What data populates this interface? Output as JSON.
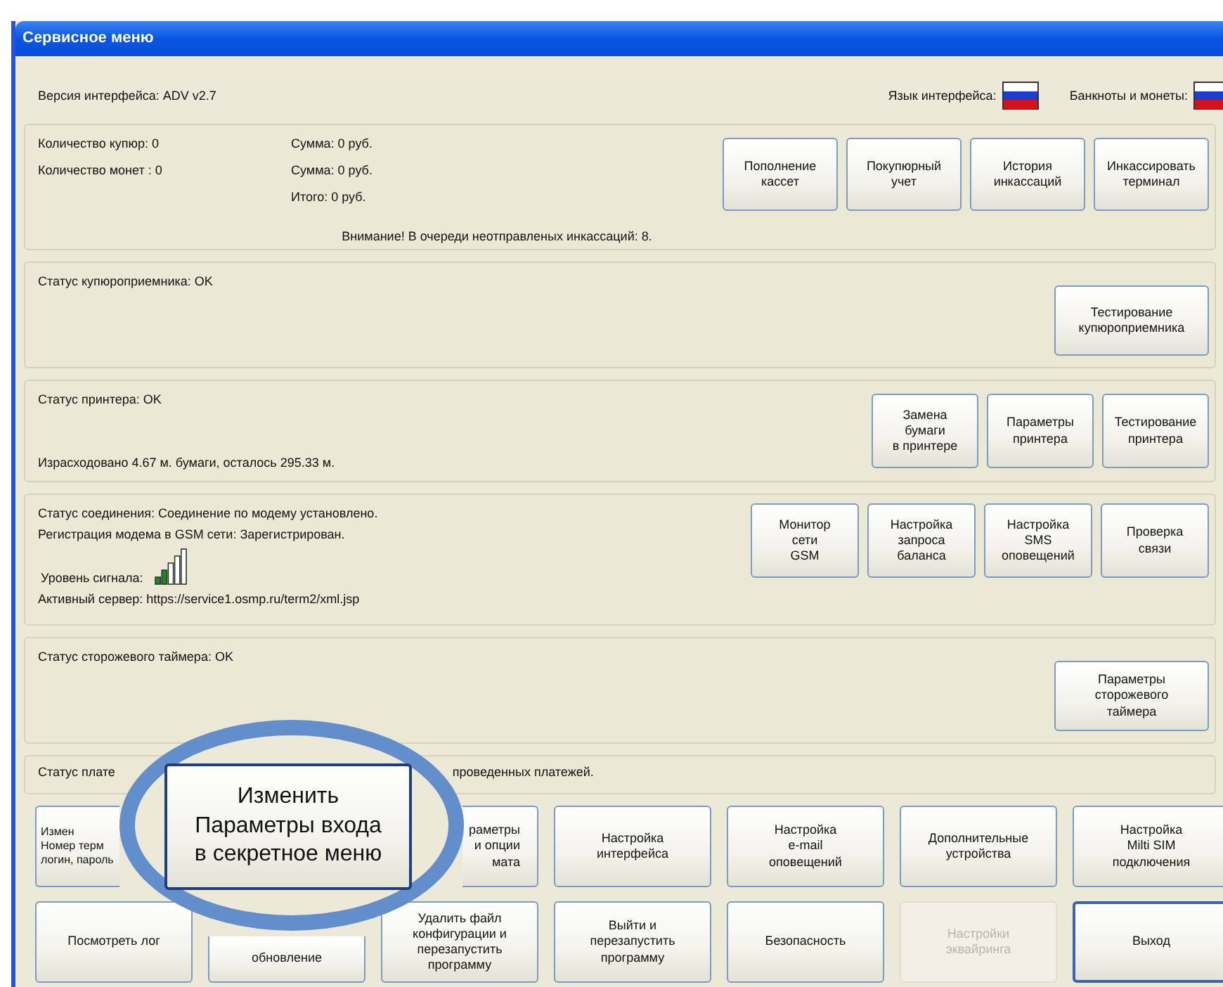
{
  "window": {
    "title": "Сервисное меню"
  },
  "header": {
    "version": "Версия интерфейса: ADV v2.7",
    "language_label": "Язык интерфейса:",
    "banknotes_label": "Банкноты и монеты:"
  },
  "panels": [
    {
      "kind": "cash",
      "lines": [
        "Количество купюр: 0",
        "Количество монет : 0"
      ],
      "sums": [
        "Сумма: 0 руб.",
        "Сумма: 0 руб.",
        "Итого: 0 руб."
      ],
      "notice": "Внимание! В очереди неотправленых инкассаций: 8.",
      "buttons": [
        "Пополнение\nкассет",
        "Покупюрный\nучет",
        "История\nинкассаций",
        "Инкассировать\nтерминал"
      ]
    },
    {
      "kind": "status",
      "lines": [
        "Статус купюроприемника:  OK"
      ],
      "buttons": [
        "Тестирование\nкупюроприемника"
      ]
    },
    {
      "kind": "printer",
      "lines": [
        "Статус принтера:  OK",
        "Израсходовано 4.67 м. бумаги, осталось 295.33 м."
      ],
      "buttons": [
        "Замена\nбумаги\nв принтере",
        "Параметры\nпринтера",
        "Тестирование\nпринтера"
      ]
    },
    {
      "kind": "connection",
      "lines": [
        "Статус соединения:  Соединение по модему установлено.",
        "Регистрация модема в GSM сети: Зарегистрирован."
      ],
      "signal_label": "Уровень сигнала:",
      "server": "Активный сервер:  https://service1.osmp.ru/term2/xml.jsp",
      "buttons": [
        "Монитор\nсети\nGSM",
        "Настройка\nзапроса\nбаланса",
        "Настройка\nSMS\nоповещений",
        "Проверка\nсвязи"
      ]
    },
    {
      "kind": "status",
      "lines": [
        "Статус сторожевого таймера:  OK"
      ],
      "buttons": [
        "Параметры\nсторожевого\nтаймера"
      ]
    },
    {
      "kind": "payments",
      "lines": [
        "Статус плате",
        "проведенных платежей."
      ]
    }
  ],
  "buttons": [
    {
      "label": "Измен\nНомер терм\nлогин, пароль",
      "kind": "covered-left",
      "disabled": false,
      "default": false
    },
    {
      "kind": "hidden"
    },
    {
      "label": "раметры\nи опции\nмата",
      "kind": "covered-right",
      "disabled": false,
      "default": false
    },
    {
      "label": "Настройка\nинтерфейса",
      "kind": "normal",
      "disabled": false,
      "default": false
    },
    {
      "label": "Настройка\ne-mail\nоповещений",
      "kind": "normal",
      "disabled": false,
      "default": false
    },
    {
      "label": "Дополнительные\nустройства",
      "kind": "normal",
      "disabled": false,
      "default": false
    },
    {
      "label": "Настройка\nMilti SIM\nподключения",
      "kind": "normal",
      "disabled": false,
      "default": false
    },
    {
      "label": "Посмотреть лог",
      "kind": "normal",
      "disabled": false,
      "default": false
    },
    {
      "label": "обновление",
      "kind": "covered-bottom",
      "disabled": false,
      "default": false
    },
    {
      "label": "Удалить файл\nконфигурации и\nперезапустить\nпрограмму",
      "kind": "normal",
      "disabled": false,
      "default": false
    },
    {
      "label": "Выйти и\nперезапустить\nпрограмму",
      "kind": "normal",
      "disabled": false,
      "default": false
    },
    {
      "label": "Безопасность",
      "kind": "normal",
      "disabled": false,
      "default": false
    },
    {
      "label": "Настройки\nэквайринга",
      "kind": "normal",
      "disabled": true,
      "default": false
    },
    {
      "label": "Выход",
      "kind": "normal",
      "disabled": false,
      "default": true
    }
  ],
  "magnifier": {
    "label": "Изменить\nПараметры входа\nв секретное меню"
  }
}
